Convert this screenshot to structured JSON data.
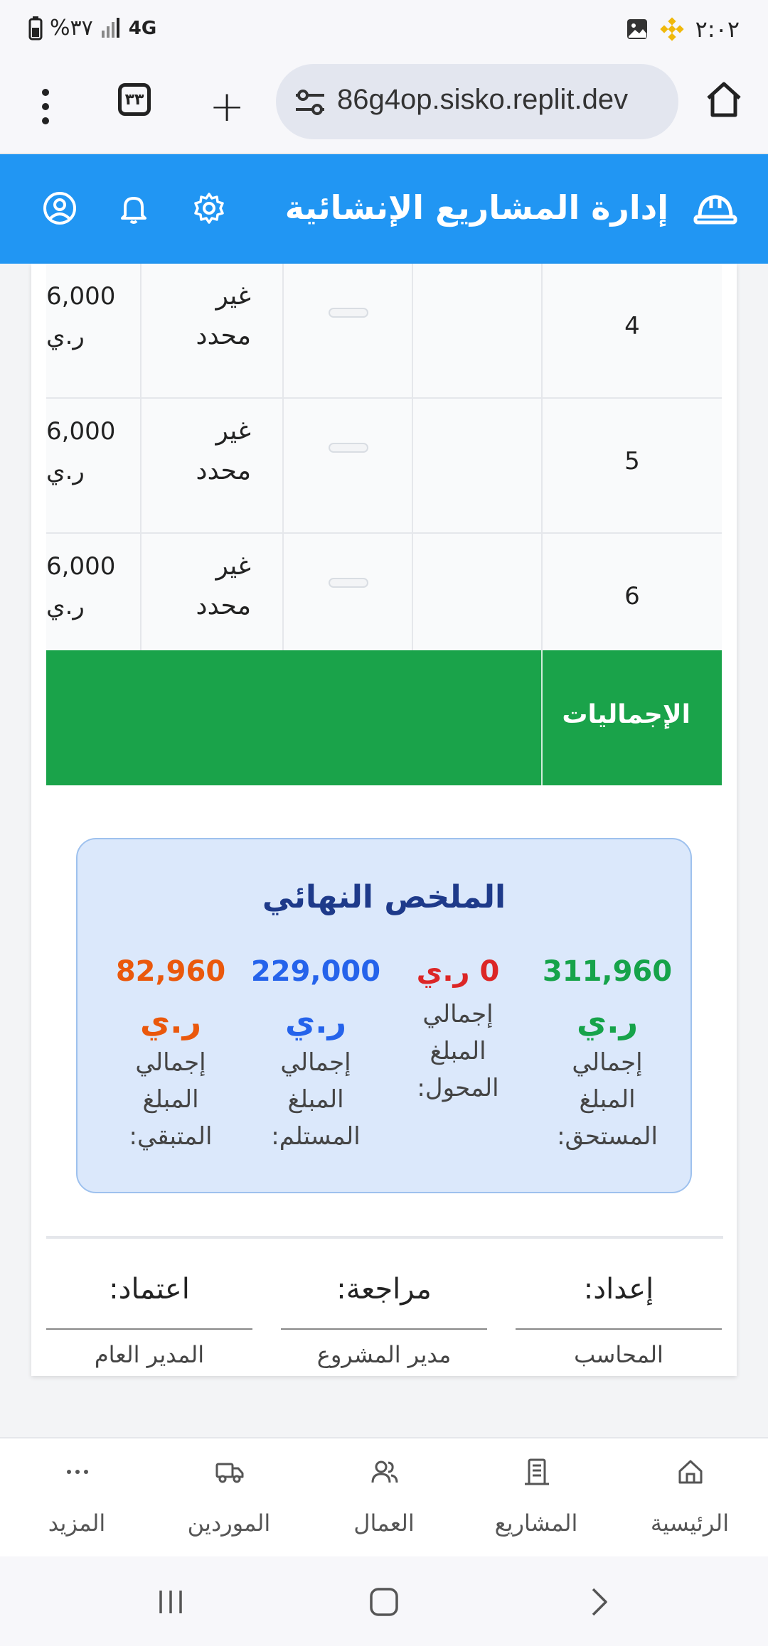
{
  "status_bar": {
    "time": "٢:٠٢",
    "battery": "%٣٧",
    "network": "4G"
  },
  "browser": {
    "tab_count": "٣٣",
    "url": "86g4op.sisko.replit.dev"
  },
  "header": {
    "title": "إدارة المشاريع الإنشائية"
  },
  "table": {
    "rows": [
      {
        "num": "4",
        "status_line1": "غير",
        "status_line2": "محدد",
        "amount": "6,000",
        "currency": "ر.ي"
      },
      {
        "num": "5",
        "status_line1": "غير",
        "status_line2": "محدد",
        "amount": "6,000",
        "currency": "ر.ي"
      },
      {
        "num": "6",
        "status_line1": "غير",
        "status_line2": "محدد",
        "amount": "6,000",
        "currency": "ر.ي"
      }
    ],
    "totals_label": "الإجماليات"
  },
  "summary": {
    "title": "الملخص النهائي",
    "items": [
      {
        "value": "311,960",
        "currency": "ر.ي",
        "label_l1": "إجمالي",
        "label_l2": "المبلغ",
        "label_l3": "المستحق:",
        "color": "#16a34a"
      },
      {
        "value": "0 ر.ي",
        "currency": "",
        "label_l1": "إجمالي",
        "label_l2": "المبلغ",
        "label_l3": "المحول:",
        "color": "#dc2626"
      },
      {
        "value": "229,000",
        "currency": "ر.ي",
        "label_l1": "إجمالي",
        "label_l2": "المبلغ",
        "label_l3": "المستلم:",
        "color": "#2563eb"
      },
      {
        "value": "82,960",
        "currency": "ر.ي",
        "label_l1": "إجمالي",
        "label_l2": "المبلغ",
        "label_l3": "المتبقي:",
        "color": "#ea580c"
      }
    ]
  },
  "signatures": [
    {
      "heading": "إعداد:",
      "name": "المحاسب"
    },
    {
      "heading": "مراجعة:",
      "name": "مدير المشروع"
    },
    {
      "heading": "اعتماد:",
      "name": "المدير العام"
    }
  ],
  "bottom_nav": {
    "home": "الرئيسية",
    "projects": "المشاريع",
    "workers": "العمال",
    "suppliers": "الموردين",
    "more": "المزيد"
  },
  "colors": {
    "header": "#2196f3",
    "totals": "#1aa34a",
    "summary_bg": "#dbe8fb"
  }
}
